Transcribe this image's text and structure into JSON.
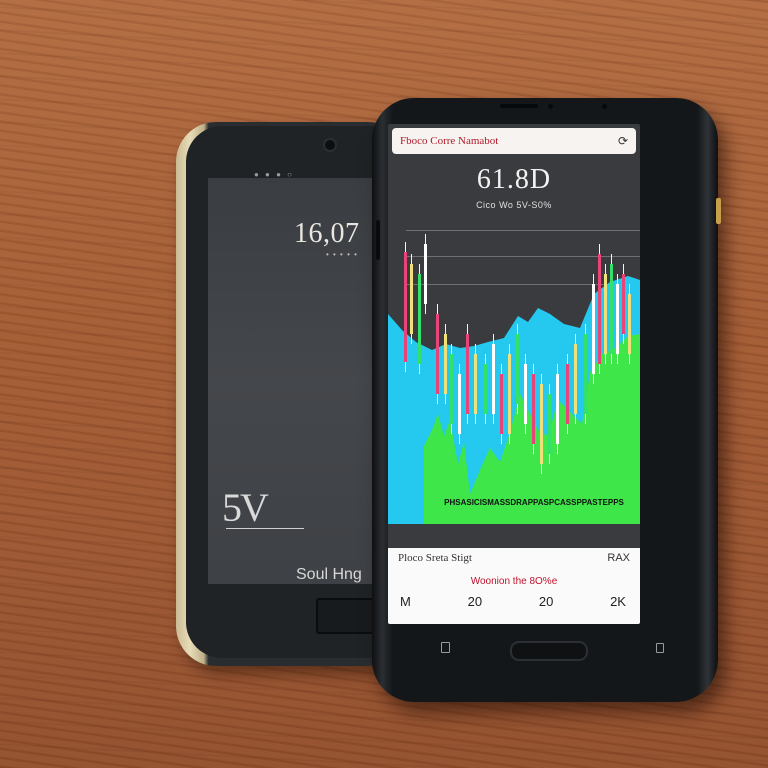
{
  "back_phone": {
    "time": "16,07",
    "logo": "5V",
    "label": "Soul Hng"
  },
  "front_phone": {
    "app_bar": {
      "title": "Fboco Corre Namabot",
      "icon": "refresh-icon"
    },
    "price": "61.8D",
    "price_sub": "Cico Wo 5V-S0%",
    "chart_label": "PHSASICISMASSDRAPPASPCASSPPASTEPPS",
    "footer": {
      "left_label": "Ploco Sreta Stigt",
      "right_label": "RAX",
      "alert": "Woonion the 8O%e",
      "stats": [
        "M",
        "20",
        "20",
        "2K"
      ]
    }
  },
  "chart_data": {
    "type": "bar",
    "series": [
      {
        "name": "candles",
        "colors": [
          "#e8447a",
          "#f0e07a",
          "#33e06a",
          "#ffffff"
        ]
      }
    ]
  },
  "colors": {
    "desk": "#a15a33",
    "area_cyan": "#25c8ef",
    "area_green": "#3fe64a",
    "candle_pink": "#e8447a",
    "alert_red": "#c0112b"
  }
}
